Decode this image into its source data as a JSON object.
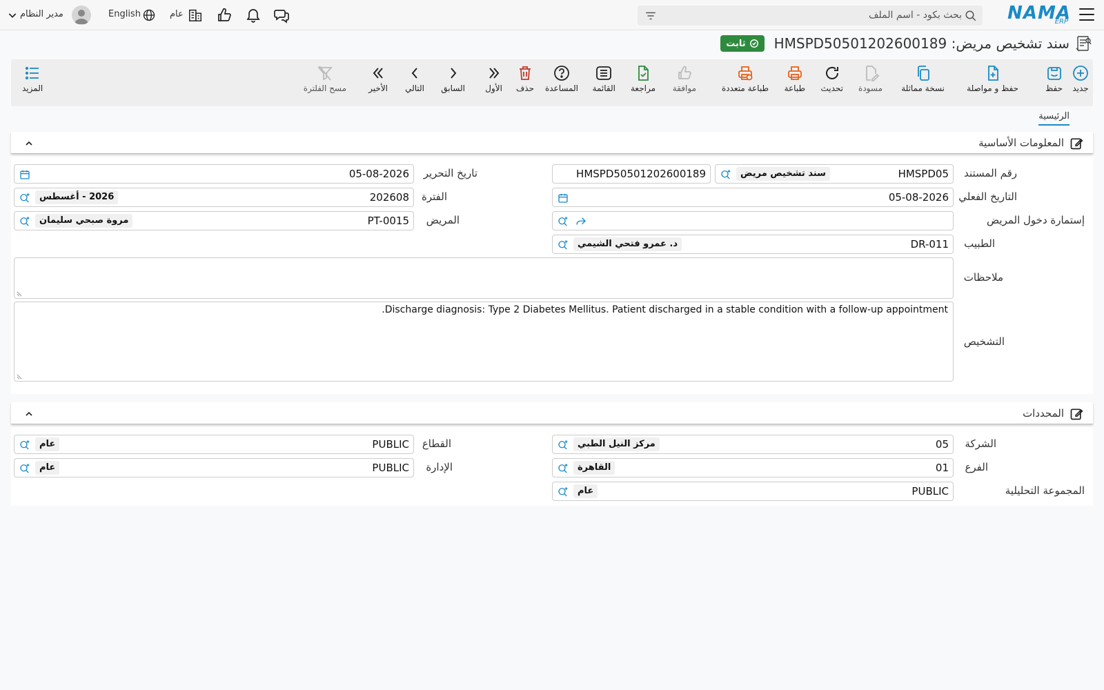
{
  "topbar": {
    "logo_text": "NAMA",
    "logo_sub": "ERP",
    "search_placeholder": "بحث بكود - اسم الملف",
    "company_label": "عام",
    "language_label": "English",
    "user_name": "مدير النظام"
  },
  "page": {
    "title": "سند تشخيص مريض: HMSPD50501202600189",
    "status": "ثابت"
  },
  "toolbar": {
    "new": "جديد",
    "save": "حفظ",
    "save_continue": "حفظ و مواصلة",
    "duplicate": "نسخة مماثلة",
    "draft": "مسودة",
    "refresh": "تحديث",
    "print": "طباعة",
    "multi_print": "طباعة متعددة",
    "approve": "موافقة",
    "review": "مراجعة",
    "list": "القائمة",
    "help": "المساعدة",
    "delete": "حذف",
    "first": "الأول",
    "previous": "السابق",
    "next": "التالي",
    "last": "الأخير",
    "clear_filter": "مسح الفلترة",
    "more": "المزيد"
  },
  "tabs": {
    "main": "الرئيسية"
  },
  "basic_info": {
    "title": "المعلومات الأساسية",
    "doc_number_label": "رقم المستند",
    "doc_number_prefix": "HMSPD05",
    "doc_type": "سند تشخيص مريض",
    "doc_number_full": "HMSPD50501202600189",
    "edit_date_label": "تاريخ التحرير",
    "edit_date": "05-08-2026",
    "actual_date_label": "التاريخ الفعلي",
    "actual_date": "05-08-2026",
    "period_label": "الفترة",
    "period_code": "202608",
    "period_name": "2026 - أغسطس",
    "admission_label": "إستمارة دخول المريض",
    "patient_label": "المريض",
    "patient_code": "PT-0015",
    "patient_name": "مروة صبحي سليمان",
    "doctor_label": "الطبيب",
    "doctor_code": "DR-011",
    "doctor_name": "د. عمرو فتحي الشيمي",
    "notes_label": "ملاحظات",
    "notes_value": "",
    "diagnosis_label": "التشخيص",
    "diagnosis_value": "Discharge diagnosis: Type 2 Diabetes Mellitus. Patient discharged in a stable condition with a follow-up appointment."
  },
  "dimensions": {
    "title": "المحددات",
    "company_label": "الشركة",
    "company_code": "05",
    "company_name": "مركز النيل الطبي",
    "sector_label": "القطاع",
    "sector_code": "PUBLIC",
    "sector_name": "عام",
    "branch_label": "الفرع",
    "branch_code": "01",
    "branch_name": "القاهرة",
    "department_label": "الإدارة",
    "department_code": "PUBLIC",
    "department_name": "عام",
    "analytic_group_label": "المجموعة التحليلية",
    "analytic_group_code": "PUBLIC",
    "analytic_group_name": "عام"
  }
}
